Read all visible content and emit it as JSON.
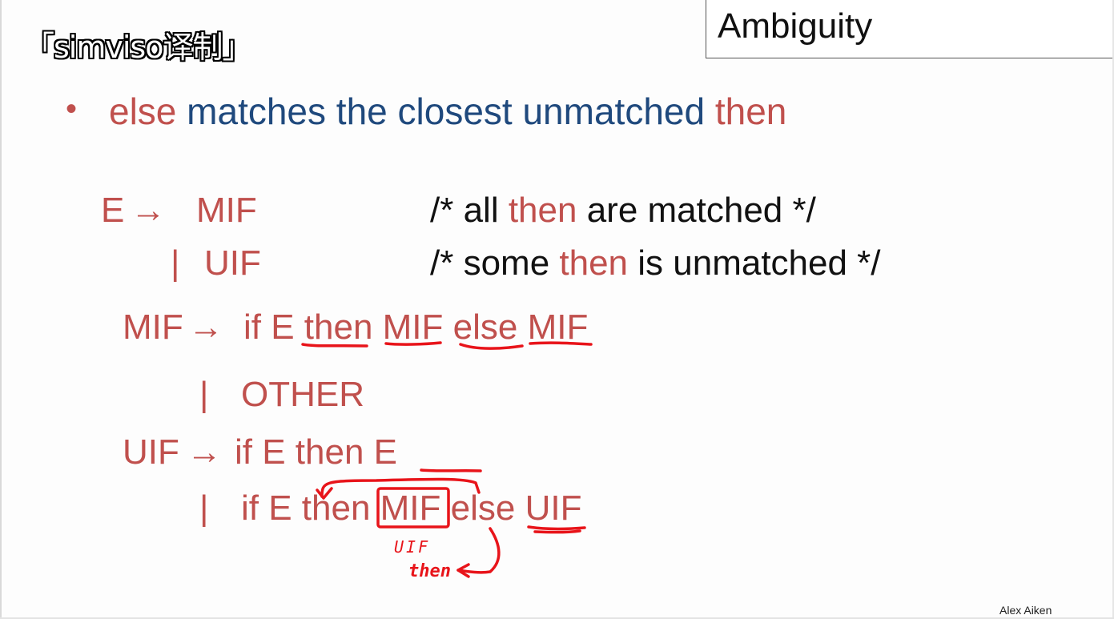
{
  "watermark": "「simviso译制」",
  "title": "Ambiguity",
  "bullet": {
    "dot": "•",
    "parts": {
      "w1": "else",
      "w2": " matches the closest unmatched ",
      "w3": "then"
    }
  },
  "grammar": {
    "e_lhs": "E",
    "arrow": "→",
    "mif": "MIF",
    "bar": "|",
    "uif": "UIF",
    "comment1": {
      "a": "/* all ",
      "b": "then",
      "c": " are matched */"
    },
    "comment2": {
      "a": "/* some ",
      "b": "then",
      "c": " is unmatched */"
    },
    "mif_rule": {
      "lhs": "MIF",
      "arrow": "→",
      "rhs": "if E then MIF else MIF"
    },
    "mif_alt": {
      "bar": "|",
      "rhs": "OTHER"
    },
    "uif_rule": {
      "lhs": "UIF",
      "arrow": "→",
      "rhs": "if E then E"
    },
    "uif_alt": {
      "bar": "|",
      "rhs": "if E then MIF else UIF"
    }
  },
  "annotations": {
    "note_uif": "UIF",
    "note_then": "then"
  },
  "colors": {
    "grammar_red": "#c0504d",
    "bullet_blue": "#1f497d",
    "ink_red": "#e8141a"
  },
  "credit": "Alex Aiken"
}
